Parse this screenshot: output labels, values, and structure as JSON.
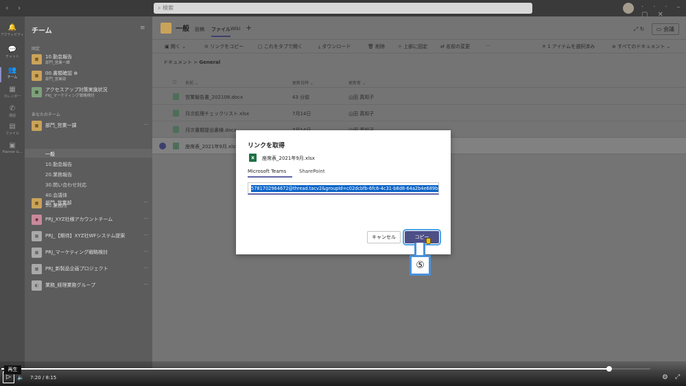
{
  "titlebar": {
    "back": "‹",
    "forward": "›",
    "search_placeholder": "検索"
  },
  "rail": [
    {
      "label": "アクティビティ",
      "icon": "bell-icon",
      "glyph": "🔔"
    },
    {
      "label": "チャット",
      "icon": "chat-icon",
      "glyph": "💬"
    },
    {
      "label": "チーム",
      "icon": "teams-icon",
      "glyph": "👥"
    },
    {
      "label": "カレンダー",
      "icon": "calendar-icon",
      "glyph": "▦"
    },
    {
      "label": "通話",
      "icon": "phone-icon",
      "glyph": "✆"
    },
    {
      "label": "ファイル",
      "icon": "file-icon",
      "glyph": "▤"
    },
    {
      "label": "Planner &...",
      "icon": "planner-icon",
      "glyph": "▣"
    }
  ],
  "teams_panel": {
    "header": "チーム",
    "pinned_label": "固定",
    "yours_label": "あなたのチーム",
    "pinned": [
      {
        "name": "10.勤怠報告",
        "sub": "部門_営業一課"
      },
      {
        "name": "00.書類確認 ⊕",
        "sub": "部門_営業部"
      },
      {
        "name": "アクセスアップ対策実施状況",
        "sub": "PRJ_マーケティング戦略検討"
      }
    ],
    "team1": "部門_営業一課",
    "channels": [
      "一般",
      "10.勤怠報告",
      "20.業務報告",
      "30.問い合わせ対応",
      "40.会議体",
      "50.業務所"
    ],
    "teams": [
      "部門_営業部",
      "PRJ_XYZ社様アカウントチーム",
      "PRJ_【期待】XYZ社WFシステム提案",
      "PRJ_マーケティング戦略検討",
      "PRJ_新製品企画プロジェクト",
      "業務_経理業務グループ"
    ],
    "more": "···"
  },
  "channel": {
    "title": "一般",
    "tabs": [
      "投稿",
      "ファイル",
      "Wiki"
    ],
    "plus": "+",
    "meeting": "会議"
  },
  "toolbar": {
    "open": "開く ⌄",
    "copy_link": "リンクをコピー",
    "open_tab": "これをタブで開く",
    "download": "ダウンロード",
    "delete": "削除",
    "pin": "上部に固定",
    "rename": "名前の変更",
    "more": "···",
    "selected": "✕ 1 アイテムを選択済み",
    "all_docs": "≡ すべてのドキュメント ⌄"
  },
  "breadcrumb": {
    "root": "ドキュメント",
    "sep": ">",
    "current": "General"
  },
  "table": {
    "headers": [
      "名前 ⌄",
      "更新日時 ⌄",
      "更新者 ⌄"
    ],
    "rows": [
      {
        "name": "営業報告書_202108.docx",
        "date": "43 分前",
        "by": "山田 真知子"
      },
      {
        "name": "月次処理チェックリスト.xlsx",
        "date": "7月14日",
        "by": "山田 真知子"
      },
      {
        "name": "月次書類提出書様.docx",
        "date": "7月14日",
        "by": "山田 真知子"
      },
      {
        "name": "座席表_2021年9月.xlsx",
        "date": "",
        "by": ""
      }
    ]
  },
  "dialog": {
    "title": "リンクを取得",
    "file_name": "座席表_2021年9月.xlsx",
    "tabs": [
      "Microsoft Teams",
      "SharePoint"
    ],
    "link": "5781702964672@thread.tacv2&groupId=c02dcbfb-6fc6-4c31-b8d8-64a2b4e689bc",
    "cancel": "キャンセル",
    "copy": "コピー"
  },
  "callout": "⑤",
  "player": {
    "tooltip": "再生",
    "play": "▷",
    "volume": "🔈",
    "time": "7:20  /  8:15",
    "progress": 0.937,
    "settings": "⚙",
    "fullscreen": "⤢"
  },
  "colors": {
    "accent": "#6264a7",
    "excel": "#1e7145",
    "highlight": "#0b64c8",
    "callout": "#4a90d9"
  }
}
